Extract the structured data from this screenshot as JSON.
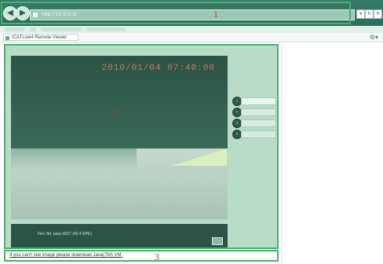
{
  "browser": {
    "address_url": "http://10.0.0.1/",
    "tab_title": "ICATLow4 Remote Viewer",
    "back_icon": "back-arrow-icon",
    "forward_icon": "forward-arrow-icon"
  },
  "video": {
    "timestamp": "2010/01/04 07:40:00"
  },
  "info_panel": {
    "text": "Fire: 8d. pass 0027 (46.4 RPE)"
  },
  "ptz": {
    "buttons": [
      {
        "icon": "ptz-button-icon",
        "glyph": "›"
      },
      {
        "icon": "ptz-button-icon",
        "glyph": "›"
      },
      {
        "icon": "ptz-button-icon",
        "glyph": "›"
      },
      {
        "icon": "ptz-button-icon",
        "glyph": "›"
      }
    ]
  },
  "footer": {
    "download_link": "If you can't see image please download Java(TM) VM."
  },
  "callouts": {
    "one": "1",
    "two": "2",
    "three": "3"
  },
  "colors": {
    "outline": "#4caf6e",
    "callout": "#c9332a",
    "timestamp": "#c97a6c"
  }
}
